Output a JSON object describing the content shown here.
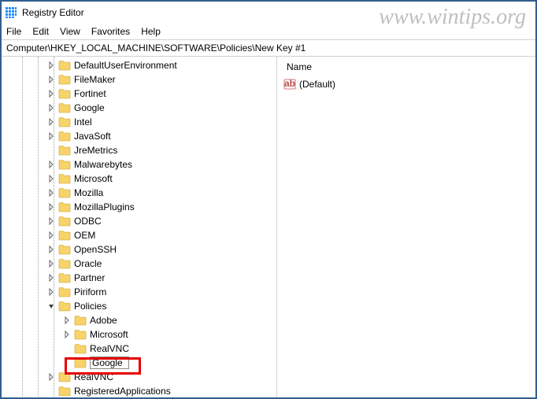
{
  "app": {
    "title": "Registry Editor"
  },
  "watermark": "www.wintips.org",
  "menu": {
    "file": "File",
    "edit": "Edit",
    "view": "View",
    "favorites": "Favorites",
    "help": "Help"
  },
  "address": {
    "path": "Computer\\HKEY_LOCAL_MACHINE\\SOFTWARE\\Policies\\New Key #1"
  },
  "tree": {
    "items": [
      {
        "label": "DefaultUserEnvironment",
        "indent": 56,
        "toggle": ">"
      },
      {
        "label": "FileMaker",
        "indent": 56,
        "toggle": ">"
      },
      {
        "label": "Fortinet",
        "indent": 56,
        "toggle": ">"
      },
      {
        "label": "Google",
        "indent": 56,
        "toggle": ">"
      },
      {
        "label": "Intel",
        "indent": 56,
        "toggle": ">"
      },
      {
        "label": "JavaSoft",
        "indent": 56,
        "toggle": ">"
      },
      {
        "label": "JreMetrics",
        "indent": 56,
        "toggle": ""
      },
      {
        "label": "Malwarebytes",
        "indent": 56,
        "toggle": ">"
      },
      {
        "label": "Microsoft",
        "indent": 56,
        "toggle": ">"
      },
      {
        "label": "Mozilla",
        "indent": 56,
        "toggle": ">"
      },
      {
        "label": "MozillaPlugins",
        "indent": 56,
        "toggle": ">"
      },
      {
        "label": "ODBC",
        "indent": 56,
        "toggle": ">"
      },
      {
        "label": "OEM",
        "indent": 56,
        "toggle": ">"
      },
      {
        "label": "OpenSSH",
        "indent": 56,
        "toggle": ">"
      },
      {
        "label": "Oracle",
        "indent": 56,
        "toggle": ">"
      },
      {
        "label": "Partner",
        "indent": 56,
        "toggle": ">"
      },
      {
        "label": "Piriform",
        "indent": 56,
        "toggle": ">"
      },
      {
        "label": "Policies",
        "indent": 56,
        "toggle": "v"
      },
      {
        "label": "Adobe",
        "indent": 76,
        "toggle": ">"
      },
      {
        "label": "Microsoft",
        "indent": 76,
        "toggle": ">"
      },
      {
        "label": "RealVNC",
        "indent": 76,
        "toggle": ""
      },
      {
        "label": "Google",
        "indent": 76,
        "toggle": "",
        "editing": true
      },
      {
        "label": "RealVNC",
        "indent": 56,
        "toggle": ">"
      },
      {
        "label": "RegisteredApplications",
        "indent": 56,
        "toggle": ""
      }
    ]
  },
  "values": {
    "header": "Name",
    "default_name": "(Default)"
  },
  "icons": {
    "folder_fill": "#f7d36a",
    "folder_tab": "#e8be45"
  }
}
